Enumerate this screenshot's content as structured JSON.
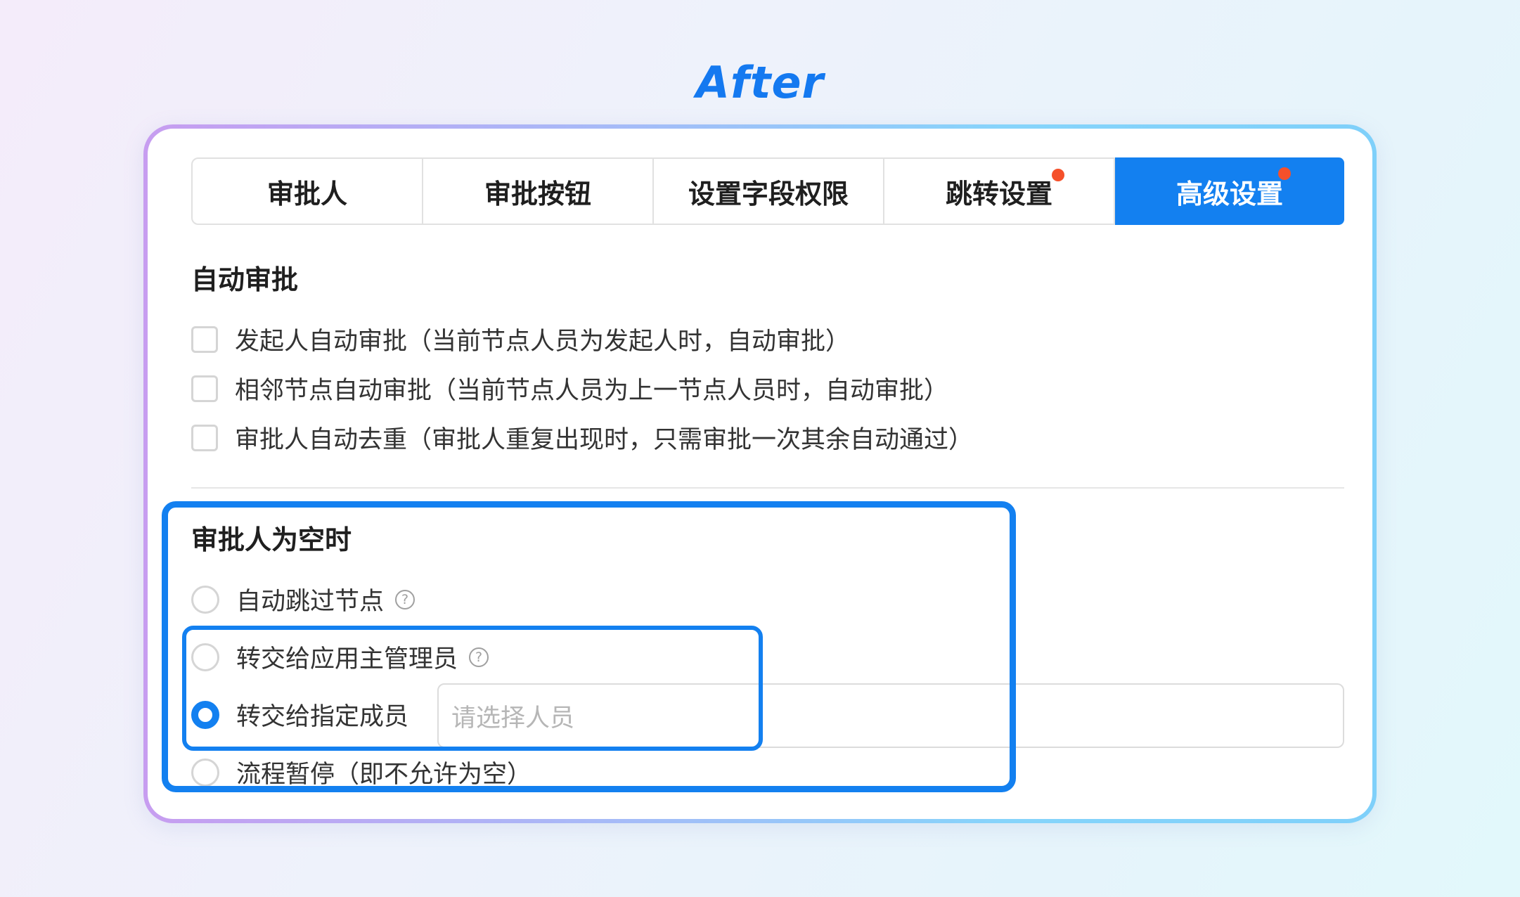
{
  "headline": "After",
  "tabs": [
    {
      "label": "审批人",
      "dot": false,
      "active": false
    },
    {
      "label": "审批按钮",
      "dot": false,
      "active": false
    },
    {
      "label": "设置字段权限",
      "dot": false,
      "active": false
    },
    {
      "label": "跳转设置",
      "dot": true,
      "active": false
    },
    {
      "label": "高级设置",
      "dot": true,
      "active": true
    }
  ],
  "auto_approve": {
    "title": "自动审批",
    "options": [
      {
        "label": "发起人自动审批（当前节点人员为发起人时，自动审批）",
        "checked": false
      },
      {
        "label": "相邻节点自动审批（当前节点人员为上一节点人员时，自动审批）",
        "checked": false
      },
      {
        "label": "审批人自动去重（审批人重复出现时，只需审批一次其余自动通过）",
        "checked": false
      }
    ]
  },
  "empty_approver": {
    "title": "审批人为空时",
    "options": [
      {
        "label": "自动跳过节点",
        "help": true,
        "selected": false
      },
      {
        "label": "转交给应用主管理员",
        "help": true,
        "selected": true
      },
      {
        "label": "转交给指定成员",
        "help": false,
        "selected": true
      },
      {
        "label": "流程暂停（即不允许为空）",
        "help": false,
        "selected": false
      }
    ],
    "member_placeholder": "请选择人员"
  },
  "help_glyph": "?",
  "colors": {
    "accent": "#1380f0",
    "dot": "#f5502a",
    "headline": "#1479f0"
  }
}
